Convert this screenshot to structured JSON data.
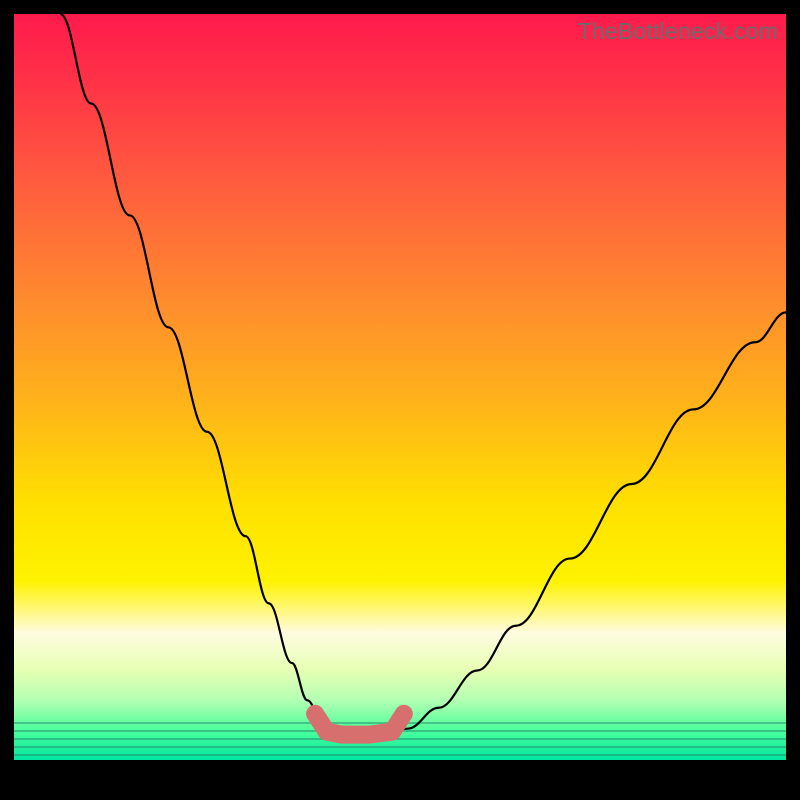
{
  "watermark": "TheBottleneck.com",
  "chart_data": {
    "type": "line",
    "title": "",
    "xlabel": "",
    "ylabel": "",
    "xlim": [
      0,
      100
    ],
    "ylim": [
      0,
      100
    ],
    "series": [
      {
        "name": "left-curve",
        "x": [
          6,
          10,
          15,
          20,
          25,
          30,
          33,
          36,
          38,
          40,
          41.5,
          42.5
        ],
        "y": [
          100,
          88,
          73,
          58,
          44,
          30,
          21,
          13,
          8,
          4.8,
          3.8,
          3.4
        ]
      },
      {
        "name": "right-curve",
        "x": [
          48,
          51,
          55,
          60,
          65,
          72,
          80,
          88,
          96,
          100
        ],
        "y": [
          3.4,
          4.2,
          7,
          12,
          18,
          27,
          37,
          47,
          56,
          60
        ]
      }
    ],
    "flat_marker": {
      "color": "#d86f6f",
      "x": [
        39,
        40.5,
        42.5,
        46,
        49,
        50.5
      ],
      "y": [
        6.2,
        3.8,
        3.4,
        3.4,
        3.8,
        6.2
      ]
    },
    "gradient_stops": {
      "top": "#ff1a4d",
      "mid_upper": "#ff8a2e",
      "mid": "#ffe100",
      "mid_lower": "#fffce0",
      "bottom": "#00e6a0"
    }
  }
}
